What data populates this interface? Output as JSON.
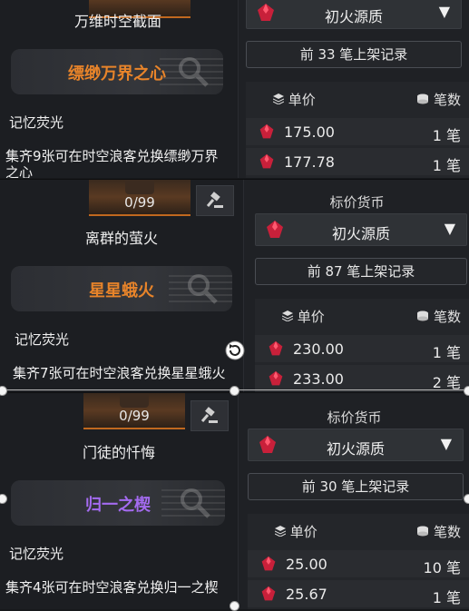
{
  "colors": {
    "orange": "#e8842a",
    "purple": "#a46bf0",
    "gem": "#c8203a"
  },
  "listings": [
    {
      "count": "",
      "item_name": "万维时空截面",
      "set_name": "缥缈万界之心",
      "set_color": "#e8842a",
      "memory_label": "记忆荧光",
      "description": "集齐9张可在时空浪客兑换缥缈万界之心",
      "currency_label": "",
      "currency": "初火源质",
      "records": "前 33 笔上架记录",
      "col_price": "单价",
      "col_count": "笔数",
      "rows": [
        {
          "price": "175.00",
          "count": "1 笔"
        },
        {
          "price": "177.78",
          "count": "1 笔"
        }
      ]
    },
    {
      "count": "0/99",
      "item_name": "离群的萤火",
      "set_name": "星星蛾火",
      "set_color": "#e8842a",
      "memory_label": "记忆荧光",
      "description": "集齐7张可在时空浪客兑换星星蛾火",
      "currency_label": "标价货币",
      "currency": "初火源质",
      "records": "前 87 笔上架记录",
      "col_price": "单价",
      "col_count": "笔数",
      "rows": [
        {
          "price": "230.00",
          "count": "1 笔"
        },
        {
          "price": "233.00",
          "count": "2 笔"
        }
      ]
    },
    {
      "count": "0/99",
      "item_name": "门徒的忏悔",
      "set_name": "归一之楔",
      "set_color": "#a46bf0",
      "memory_label": "记忆荧光",
      "description": "集齐4张可在时空浪客兑换归一之楔",
      "currency_label": "标价货币",
      "currency": "初火源质",
      "records": "前 30 笔上架记录",
      "col_price": "单价",
      "col_count": "笔数",
      "rows": [
        {
          "price": "25.00",
          "count": "10 笔"
        },
        {
          "price": "25.67",
          "count": "1 笔"
        }
      ]
    }
  ]
}
